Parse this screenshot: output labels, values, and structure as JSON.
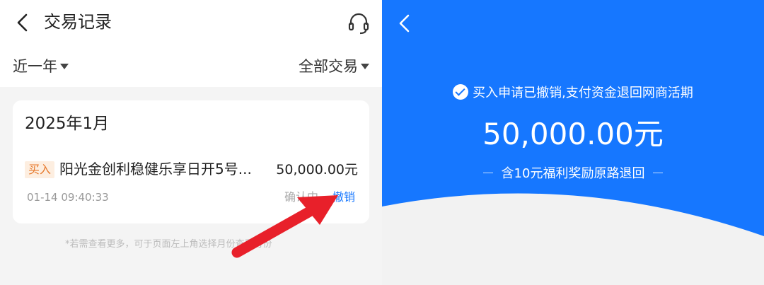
{
  "left": {
    "nav": {
      "title": "交易记录",
      "back_icon": "chevron-left-icon",
      "support_icon": "headset-icon"
    },
    "filters": {
      "period": "近一年",
      "type": "全部交易"
    },
    "card": {
      "month": "2025年1月",
      "transaction": {
        "tag": "买入",
        "fund_name": "阳光金创利稳健乐享日开5号...",
        "amount": "50,000.00元",
        "time": "01-14 09:40:33",
        "status": "确认中",
        "action": "撤销"
      }
    },
    "footnote": "*若需查看更多，可于页面左上角选择月份查看月份",
    "annotation_color": "#e8202a"
  },
  "right": {
    "back_icon": "chevron-left-icon",
    "notice": "买入申请已撤销,支付资金退回网商活期",
    "amount": "50,000.00元",
    "sub_notice": "含10元福利奖励原路退回",
    "accent": "#1677ff"
  }
}
